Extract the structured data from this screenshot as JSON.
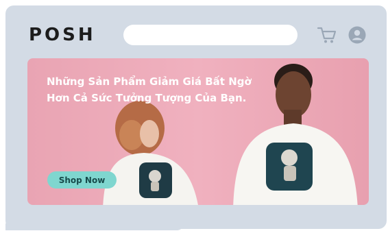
{
  "header": {
    "logo_text": "POSH",
    "search": {
      "placeholder": "",
      "value": ""
    },
    "icons": [
      "cart-icon",
      "user-icon"
    ]
  },
  "hero": {
    "headline": "Những Sản Phẩm Giảm Giá Bất Ngờ Hơn Cả Sức Tưởng Tượng Của Bạn.",
    "cta_label": "Shop Now",
    "colors": {
      "background": "#eea9b8",
      "cta": "#7fd6cf",
      "frame": "#d3dbe5"
    }
  }
}
